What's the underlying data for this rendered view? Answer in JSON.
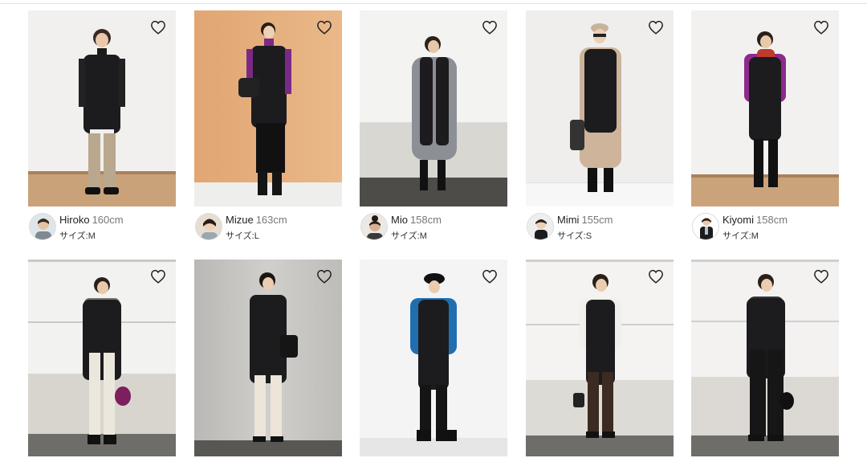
{
  "row1": [
    {
      "name": "Hiroko",
      "height": "160cm",
      "size": "サイズ:M"
    },
    {
      "name": "Mizue",
      "height": "163cm",
      "size": "サイズ:L"
    },
    {
      "name": "Mio",
      "height": "158cm",
      "size": "サイズ:M"
    },
    {
      "name": "Mimi",
      "height": "155cm",
      "size": "サイズ:S"
    },
    {
      "name": "Kiyomi",
      "height": "158cm",
      "size": "サイズ:M"
    }
  ],
  "colors": {
    "vest": "#1c1c1e",
    "heart_stroke": "#222222",
    "height_text": "#777777",
    "floor_wood": "#caa37a",
    "wall_orange": "#e2aa7a"
  },
  "icons": {
    "favorite": "heart-outline-icon"
  }
}
